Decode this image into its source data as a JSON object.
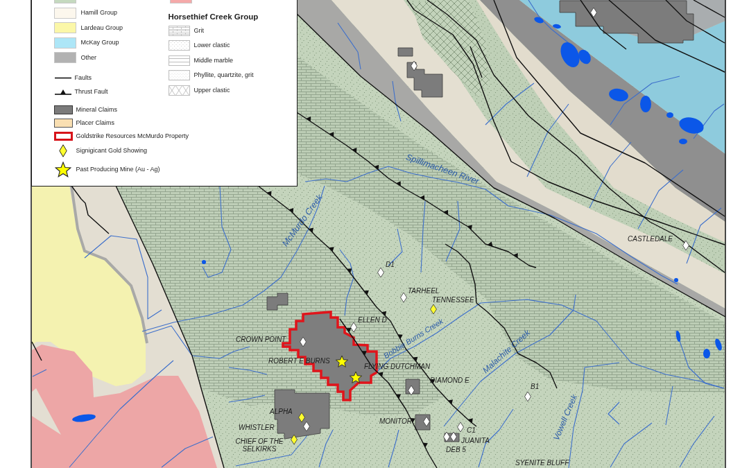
{
  "legend": {
    "units": [
      {
        "color": "#c5d9bf"
      },
      {
        "label": "Hamill Group",
        "color": "#fcf7ed"
      },
      {
        "label": "Lardeau Group",
        "color": "#fbf7a8"
      },
      {
        "label": "McKay Group",
        "color": "#ade6f7"
      },
      {
        "label": "Other",
        "color": "#b2b2b2"
      }
    ],
    "lines": [
      {
        "label": "Faults",
        "kind": "fault"
      },
      {
        "label": "Thrust Fault",
        "kind": "thrust"
      }
    ],
    "symbols": [
      {
        "label": "Mineral Claims",
        "kind": "mineral"
      },
      {
        "label": "Placer Claims",
        "kind": "placer"
      },
      {
        "label": "Goldstrike Resources McMurdo Property",
        "kind": "property"
      },
      {
        "label": "Signigicant Gold Showing",
        "kind": "gold_showing"
      },
      {
        "label": "Past Producing Mine (Au - Ag)",
        "kind": "mine"
      }
    ],
    "right_column_unit": {
      "color": "#f5a9a9"
    },
    "group_title": "Horsethief Creek Group",
    "patterns": [
      {
        "label": "Grit",
        "kind": "brick"
      },
      {
        "label": "Lower clastic",
        "kind": "dots"
      },
      {
        "label": "Middle marble",
        "kind": "lines"
      },
      {
        "label": "Phyllite, quartzite, grit",
        "kind": "speckle"
      },
      {
        "label": "Upper clastic",
        "kind": "cross"
      }
    ]
  },
  "map": {
    "water_labels": [
      "Spillimacheen River",
      "McMurdo Creek",
      "Bobbie Burns Creek",
      "Malachite Creek",
      "Vowell Creek"
    ],
    "place_labels": [
      "CASTLEDALE",
      "D1",
      "TARHEEL",
      "TENNESSEE",
      "ELLEN D",
      "CROWN POINT",
      "ROBERT E BURNS",
      "FLYING DUTCHMAN",
      "DIAMOND E",
      "B1",
      "ALPHA",
      "MONITOR",
      "WHISTLER",
      "C1",
      "JUANITA",
      "CHIEF OF THE SELKIRKS",
      "DEB 5",
      "SYENITE BLUFF"
    ],
    "markers": [
      {
        "kind": "showing"
      },
      {
        "kind": "showing"
      },
      {
        "kind": "showing"
      },
      {
        "kind": "showing"
      },
      {
        "kind": "showing"
      },
      {
        "kind": "gold_showing"
      },
      {
        "kind": "showing"
      },
      {
        "kind": "showing"
      },
      {
        "kind": "mine"
      },
      {
        "kind": "mine"
      },
      {
        "kind": "showing"
      },
      {
        "kind": "showing"
      },
      {
        "kind": "gold_showing"
      },
      {
        "kind": "showing"
      },
      {
        "kind": "showing"
      },
      {
        "kind": "showing"
      },
      {
        "kind": "showing"
      },
      {
        "kind": "showing"
      },
      {
        "kind": "gold_showing"
      }
    ]
  }
}
